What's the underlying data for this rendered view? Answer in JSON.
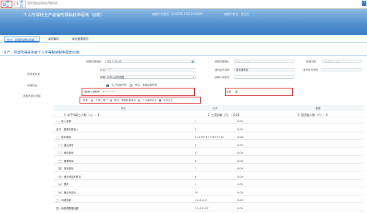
{
  "toolbar": {
    "save": "保存",
    "back": "返回"
  },
  "header": {
    "org_line": "国家税务总局电子税务局",
    "title": "个人所得税生产经营所得纳税申报表（B表）",
    "id_label": "纳税人识别号：",
    "id_value": "510225195212091800",
    "name_label": "纳税人姓名：",
    "name_value": "张天文"
  },
  "tabs": [
    "生产、经营所得投资者...",
    "减免事项",
    "商业健康保险"
  ],
  "subtitle": "生产、经营所得投资者个人所得税纳税申报表(B表)",
  "form": {
    "period_start_label": "税款所属期起",
    "period_start": "2017-01-01",
    "period_end_label": "税款所属期止",
    "period_end": "2017-12-31",
    "fill_date_label": "填报日期",
    "fill_date": "2018-11-08",
    "investor_label": "投资者信息",
    "name_label": "姓名",
    "name_value": "·······",
    "id_type_label": "身份证件类型",
    "id_type_value": "居民身份证",
    "id_no_label": "身份证件号码",
    "nationality_label": "国籍",
    "nationality_value": "中华人民共和国",
    "taxpayer_id_label": "纳税人识别号",
    "item_label": "所得项目",
    "item_opt1": "生产经营所得",
    "item_opt2": "承包、承租经营所得",
    "unit_label": "被投资单位信息",
    "unit_id_label": "*纳税人识别号",
    "unit_id_value": "9··············",
    "unit_name_label": "名称",
    "unit_name_value": "善",
    "type_label": "类型",
    "type_opts": [
      "个体工商户",
      "承包、承租经营单位",
      "个人独资企业",
      "合伙企业"
    ]
  },
  "table": {
    "head": [
      "项目",
      "行次",
      "金额"
    ],
    "meta": [
      {
        "label": "1. 年平均职工人数（人）：",
        "value": "1"
      },
      {
        "label": "2. 工资总额（元）：",
        "value": "0.00"
      },
      {
        "label": "3. 投资者人数（人）：",
        "value": "0"
      }
    ],
    "rows": [
      {
        "item": "一、收入总额",
        "line": "1",
        "amount": "0.00"
      },
      {
        "item": "其中：国债利息收入",
        "line": "2",
        "amount": "0.00"
      },
      {
        "item": "二、成本费用",
        "line": "3=4+5+6+7+8+9+10",
        "amount": "0.00"
      },
      {
        "item": "（一）营业成本",
        "line": "4",
        "amount": "0.00"
      },
      {
        "item": "（二）营业费用",
        "line": "5",
        "amount": "0.00"
      },
      {
        "item": "（三）管理费用",
        "line": "6",
        "amount": "0.00"
      },
      {
        "item": "（四）财务费用",
        "line": "7",
        "amount": "0.00"
      },
      {
        "item": "（五）营业税金及附加",
        "line": "8",
        "amount": "0.00"
      },
      {
        "item": "（六）损失",
        "line": "9",
        "amount": "0.00"
      },
      {
        "item": "（七）营业外支出",
        "line": "10",
        "amount": "0.00"
      },
      {
        "item": "三、利润总额",
        "line": "11=1-2-3",
        "amount": "0.00"
      },
      {
        "item": "四、纳税调整增加额",
        "line": "12=13+27",
        "amount": "0.00"
      }
    ]
  }
}
